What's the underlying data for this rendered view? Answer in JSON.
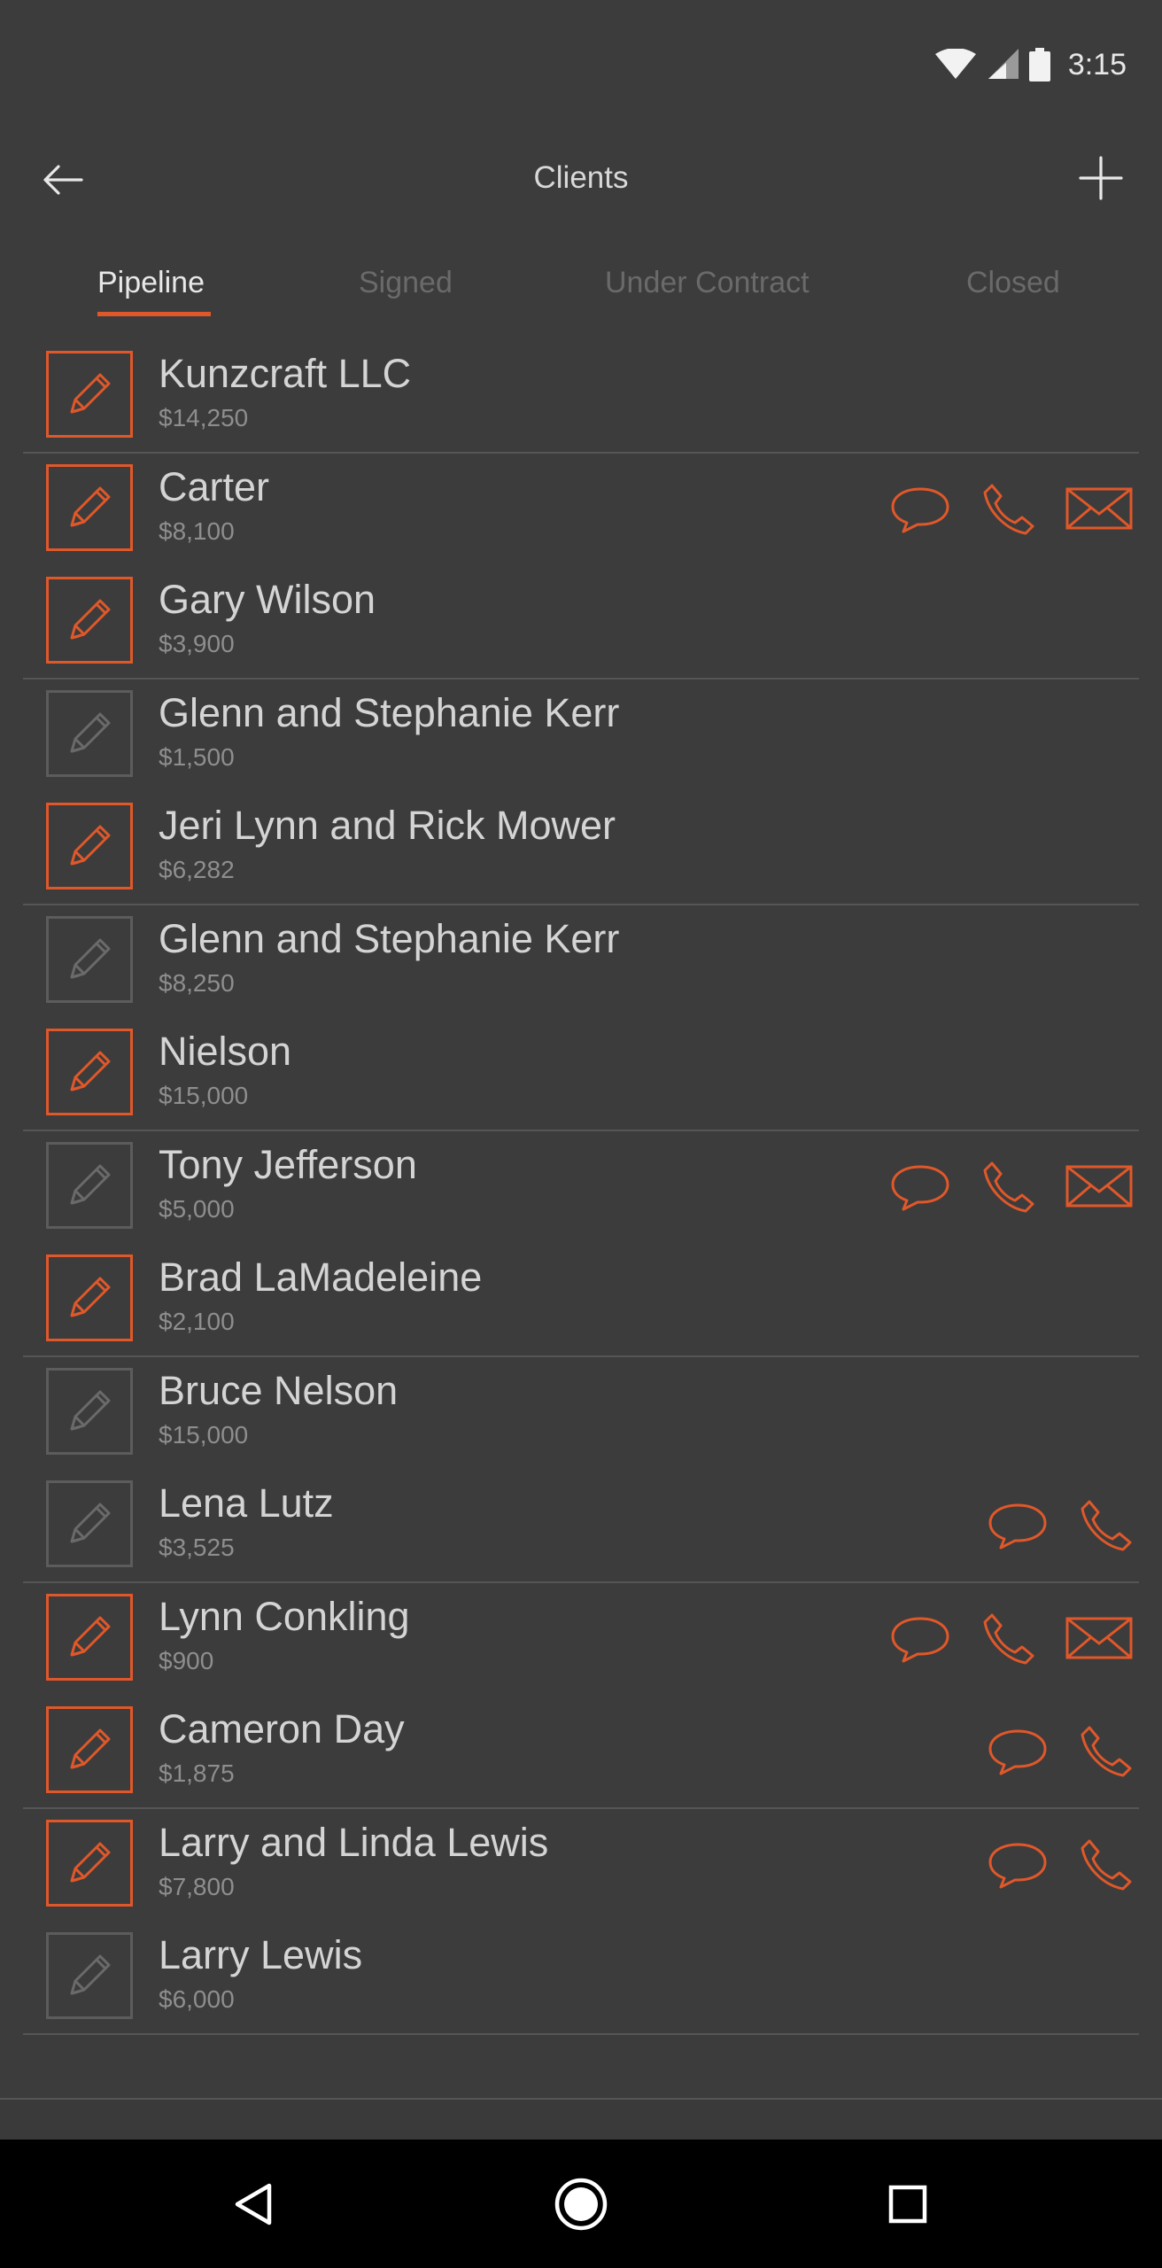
{
  "status_bar": {
    "time": "3:15",
    "icons": [
      "wifi-icon",
      "signal-icon",
      "battery-icon"
    ]
  },
  "header": {
    "title": "Clients",
    "back_icon": "arrow-left-icon",
    "add_icon": "plus-icon"
  },
  "tabs": [
    {
      "label": "Pipeline",
      "active": true
    },
    {
      "label": "Signed",
      "active": false
    },
    {
      "label": "Under Contract",
      "active": false
    },
    {
      "label": "Closed",
      "active": false
    }
  ],
  "clients": [
    {
      "name": "Kunzcraft LLC",
      "amount": "$14,250",
      "active": true,
      "actions": []
    },
    {
      "name": "Carter",
      "amount": "$8,100",
      "active": true,
      "actions": [
        "message",
        "phone",
        "email"
      ]
    },
    {
      "name": "Gary Wilson",
      "amount": "$3,900",
      "active": true,
      "actions": []
    },
    {
      "name": "Glenn and Stephanie Kerr",
      "amount": "$1,500",
      "active": false,
      "actions": []
    },
    {
      "name": "Jeri Lynn and Rick Mower",
      "amount": "$6,282",
      "active": true,
      "actions": []
    },
    {
      "name": "Glenn and Stephanie Kerr",
      "amount": "$8,250",
      "active": false,
      "actions": []
    },
    {
      "name": "Nielson",
      "amount": "$15,000",
      "active": true,
      "actions": []
    },
    {
      "name": "Tony Jefferson",
      "amount": "$5,000",
      "active": false,
      "actions": [
        "message",
        "phone",
        "email"
      ]
    },
    {
      "name": "Brad LaMadeleine",
      "amount": "$2,100",
      "active": true,
      "actions": []
    },
    {
      "name": "Bruce Nelson",
      "amount": "$15,000",
      "active": false,
      "actions": []
    },
    {
      "name": "Lena Lutz",
      "amount": "$3,525",
      "active": false,
      "actions": [
        "message",
        "phone"
      ]
    },
    {
      "name": "Lynn Conkling",
      "amount": "$900",
      "active": true,
      "actions": [
        "message",
        "phone",
        "email"
      ]
    },
    {
      "name": "Cameron Day",
      "amount": "$1,875",
      "active": true,
      "actions": [
        "message",
        "phone"
      ]
    },
    {
      "name": "Larry and Linda Lewis",
      "amount": "$7,800",
      "active": true,
      "actions": [
        "message",
        "phone"
      ]
    },
    {
      "name": "Larry Lewis",
      "amount": "$6,000",
      "active": false,
      "actions": []
    }
  ],
  "nav_bar": {
    "buttons": [
      "back-triangle-icon",
      "home-circle-icon",
      "recents-square-icon"
    ]
  },
  "colors": {
    "accent": "#e0582a",
    "background": "#3c3c3c",
    "inactive_border": "#5c5c5c"
  }
}
